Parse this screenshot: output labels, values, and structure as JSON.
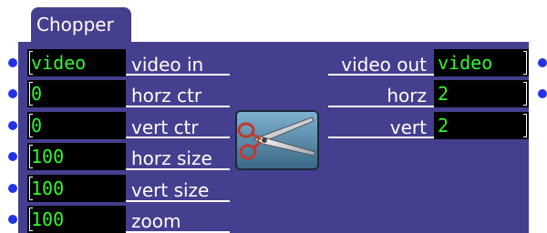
{
  "actor": {
    "title": "Chopper",
    "icon": "scissors-icon"
  },
  "inputs": [
    {
      "value": "video",
      "label": "video in"
    },
    {
      "value": "0",
      "label": "horz ctr"
    },
    {
      "value": "0",
      "label": "vert ctr"
    },
    {
      "value": "100",
      "label": "horz size"
    },
    {
      "value": "100",
      "label": "vert size"
    },
    {
      "value": "100",
      "label": "zoom"
    }
  ],
  "outputs": [
    {
      "value": "video",
      "label": "video out"
    },
    {
      "value": "2",
      "label": "horz"
    },
    {
      "value": "2",
      "label": "vert"
    }
  ],
  "colors": {
    "panel": "#453f8f",
    "field_bg": "#000000",
    "value_text": "#2ff82f",
    "port": "#2233e6"
  }
}
